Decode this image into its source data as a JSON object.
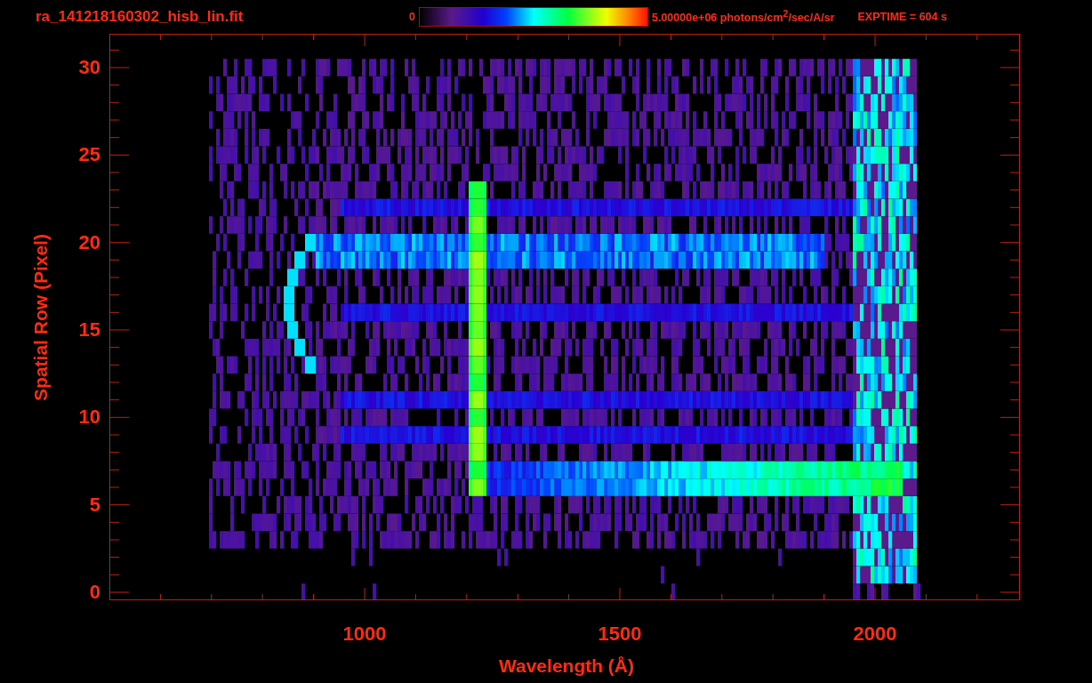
{
  "title": "ra_141218160302_hisb_lin.fit",
  "colorbar": {
    "min_label": "0",
    "max_label": "5.00000e+06 photons/cm$^{2}$/sec/A/sr"
  },
  "exposure": "EXPTIME = 604 s",
  "plot": {
    "xlabel": "Wavelength (Å)",
    "ylabel": "Spatial Row (Pixel)",
    "xtick_labels": [
      "1000",
      "1500",
      "2000"
    ],
    "ytick_labels": [
      "30",
      "25",
      "20",
      "15",
      "10",
      "5",
      "0"
    ]
  }
}
